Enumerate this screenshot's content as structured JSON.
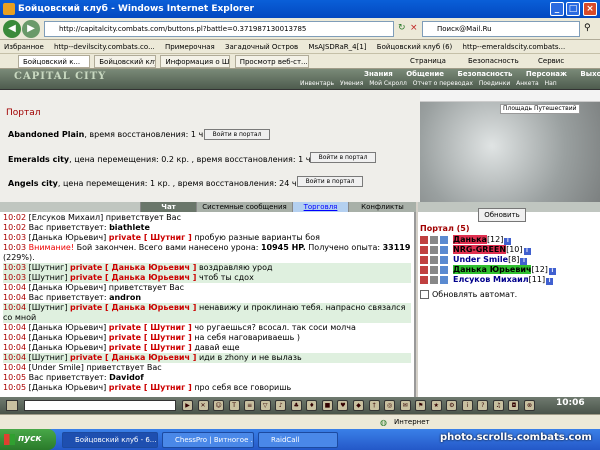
{
  "window": {
    "title": "Бойцовский клуб - Windows Internet Explorer"
  },
  "browser": {
    "address": "http://capitalcity.combats.com/buttons.pl?battle=0.371987130013785",
    "search_placeholder": "Поиск@Mail.Ru",
    "favorites": [
      "Избранное",
      "http--devilscity.combats.co...",
      "Примерочная",
      "Загадочный Остров",
      "MsAJSDRaR_4[1]",
      "Бойцовский клуб (6)",
      "http--emeraldscity.combats..."
    ],
    "tabs": [
      "Бойцовский к...",
      "Бойцовский клуб",
      "Информация о Ш...",
      "Просмотр веб-ст..."
    ],
    "menu": [
      "Страница",
      "Безопасность",
      "Сервис"
    ]
  },
  "game": {
    "logo": "CAPITAL CITY",
    "topmenu": [
      "Знания",
      "Общение",
      "Безопасность",
      "Персонаж",
      "Выход"
    ],
    "submenu": [
      "Инвентарь",
      "Умения",
      "Мой Скролл",
      "Отчет о переводах",
      "Поединки",
      "Анкета",
      "Нап"
    ]
  },
  "portal": {
    "title": "Портал",
    "map_label": "Площадь Путешествий",
    "lines": [
      {
        "name": "Abandoned Plain",
        "text": ", время восстановления: 1 ч.",
        "button": "Войти в портал"
      },
      {
        "name": "Emeralds city",
        "text": ", цена перемещения: 0.2 кр. , время восстановления: 1 ч.",
        "button": "Войти в портал"
      },
      {
        "name": "Angels city",
        "text": ", цена перемещения: 1 кр. , время восстановления: 24 ч.",
        "button": "Войти в портал"
      }
    ]
  },
  "chat": {
    "tabs": [
      "Чат",
      "Системные сообщения",
      "Торговля",
      "Конфликты"
    ],
    "lines": [
      {
        "t": "10:02",
        "parts": [
          [
            "nm",
            "[Елсуков Михаил]"
          ],
          [
            "",
            "приветствует Вас"
          ]
        ]
      },
      {
        "t": "10:02",
        "parts": [
          [
            "",
            "Вас приветствует:"
          ],
          [
            "b",
            "biathlete"
          ]
        ]
      },
      {
        "t": "10:03",
        "parts": [
          [
            "nm",
            "[Данька Юрьевич]"
          ],
          [
            "pv",
            "private [ Шутниг ]"
          ],
          [
            "",
            "пробую разные варианты боя"
          ]
        ]
      },
      {
        "t": "10:03",
        "parts": [
          [
            "rd",
            "Внимание!"
          ],
          [
            "",
            "Бой закончен. Всего вами нанесено урона:"
          ],
          [
            "b",
            "10945 HP."
          ],
          [
            "",
            "Получено опыта:"
          ],
          [
            "b",
            "33119"
          ],
          [
            "",
            "(229%)."
          ]
        ],
        "wrap": true
      },
      {
        "t": "10:03",
        "hl": true,
        "parts": [
          [
            "nm",
            "[Шутниг]"
          ],
          [
            "pv",
            "private [ Данька Юрьевич ]"
          ],
          [
            "",
            "воздравляю урод"
          ]
        ]
      },
      {
        "t": "10:03",
        "hl": true,
        "parts": [
          [
            "nm",
            "[Шутниг]"
          ],
          [
            "pv",
            "private [ Данька Юрьевич ]"
          ],
          [
            "",
            "чтоб ты сдох"
          ]
        ]
      },
      {
        "t": "10:04",
        "parts": [
          [
            "nm",
            "[Данька Юрьевич]"
          ],
          [
            "",
            "приветствует Вас"
          ]
        ]
      },
      {
        "t": "10:04",
        "parts": [
          [
            "",
            "Вас приветствует:"
          ],
          [
            "b",
            "andron"
          ]
        ]
      },
      {
        "t": "10:04",
        "hl": true,
        "parts": [
          [
            "nm",
            "[Шутниг]"
          ],
          [
            "pv",
            "private [ Данька Юрьевич ]"
          ],
          [
            "",
            "ненавижу и проклинаю тебя. напрасно связался со мной"
          ]
        ],
        "wrap": true
      },
      {
        "t": "10:04",
        "parts": [
          [
            "nm",
            "[Данька Юрьевич]"
          ],
          [
            "pv",
            "private [ Шутниг ]"
          ],
          [
            "",
            "чо ругаешься? всосал. так соси молча"
          ]
        ]
      },
      {
        "t": "10:04",
        "parts": [
          [
            "nm",
            "[Данька Юрьевич]"
          ],
          [
            "pv",
            "private [ Шутниг ]"
          ],
          [
            "",
            "на себя наговариваешь )"
          ]
        ]
      },
      {
        "t": "10:04",
        "parts": [
          [
            "nm",
            "[Данька Юрьевич]"
          ],
          [
            "pv",
            "private [ Шутниг ]"
          ],
          [
            "",
            "давай еще"
          ]
        ]
      },
      {
        "t": "10:04",
        "hl": true,
        "parts": [
          [
            "nm",
            "[Шутниг]"
          ],
          [
            "pv",
            "private [ Данька Юрьевич ]"
          ],
          [
            "",
            "иди в zhony и не вылазь"
          ]
        ]
      },
      {
        "t": "10:04",
        "parts": [
          [
            "nm",
            "[Under Smile]"
          ],
          [
            "",
            "приветствует Вас"
          ]
        ]
      },
      {
        "t": "10:05",
        "parts": [
          [
            "",
            "Вас приветствует:"
          ],
          [
            "b",
            "Davidof"
          ]
        ]
      },
      {
        "t": "10:05",
        "parts": [
          [
            "nm",
            "[Данька Юрьевич]"
          ],
          [
            "pv",
            "private [ Шутниг ]"
          ],
          [
            "",
            "про себя все говоришь"
          ]
        ]
      }
    ]
  },
  "online": {
    "refresh": "Обновить",
    "title": "Портал (5)",
    "players": [
      {
        "name": "Данька",
        "level": "[12]",
        "style": "red"
      },
      {
        "name": "NRG-GREEN",
        "level": "[10]",
        "style": "red"
      },
      {
        "name": "Under Smile",
        "level": "[8]",
        "style": ""
      },
      {
        "name": "Данька Юрьевич",
        "level": "[12]",
        "style": "green"
      },
      {
        "name": "Елсуков Михаил",
        "level": "[11]",
        "style": ""
      }
    ],
    "auto_label": "Обновлять автомат."
  },
  "bottombar": {
    "clock": "10:06"
  },
  "statusbar": {
    "zone": "Интернет"
  },
  "taskbar": {
    "start": "пуск",
    "items": [
      "Бойцовский клуб - 6...",
      "ChessPro | Витногое ...",
      "RaidCall"
    ]
  },
  "watermark": "photo.scrolls.combats.com"
}
